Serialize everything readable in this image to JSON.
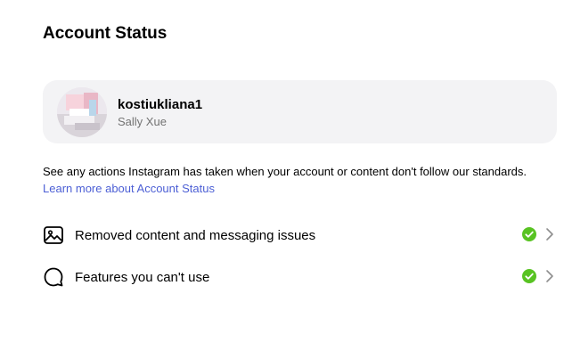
{
  "page": {
    "title": "Account Status"
  },
  "account": {
    "username": "kostiukliana1",
    "display_name": "Sally Xue",
    "avatar_icon": "profile-photo"
  },
  "description": {
    "text": "See any actions Instagram has taken when your account or content don't follow our standards. ",
    "link_label": "Learn more about Account Status"
  },
  "status_items": [
    {
      "label": "Removed content and messaging issues",
      "icon": "image-icon",
      "status_icon": "check-circle-icon",
      "status": "ok"
    },
    {
      "label": "Features you can't use",
      "icon": "speech-bubble-icon",
      "status_icon": "check-circle-icon",
      "status": "ok"
    }
  ],
  "colors": {
    "link": "#4c5fd5",
    "status_ok": "#58c322",
    "card_background": "#f3f3f5",
    "secondary_text": "#737373"
  }
}
